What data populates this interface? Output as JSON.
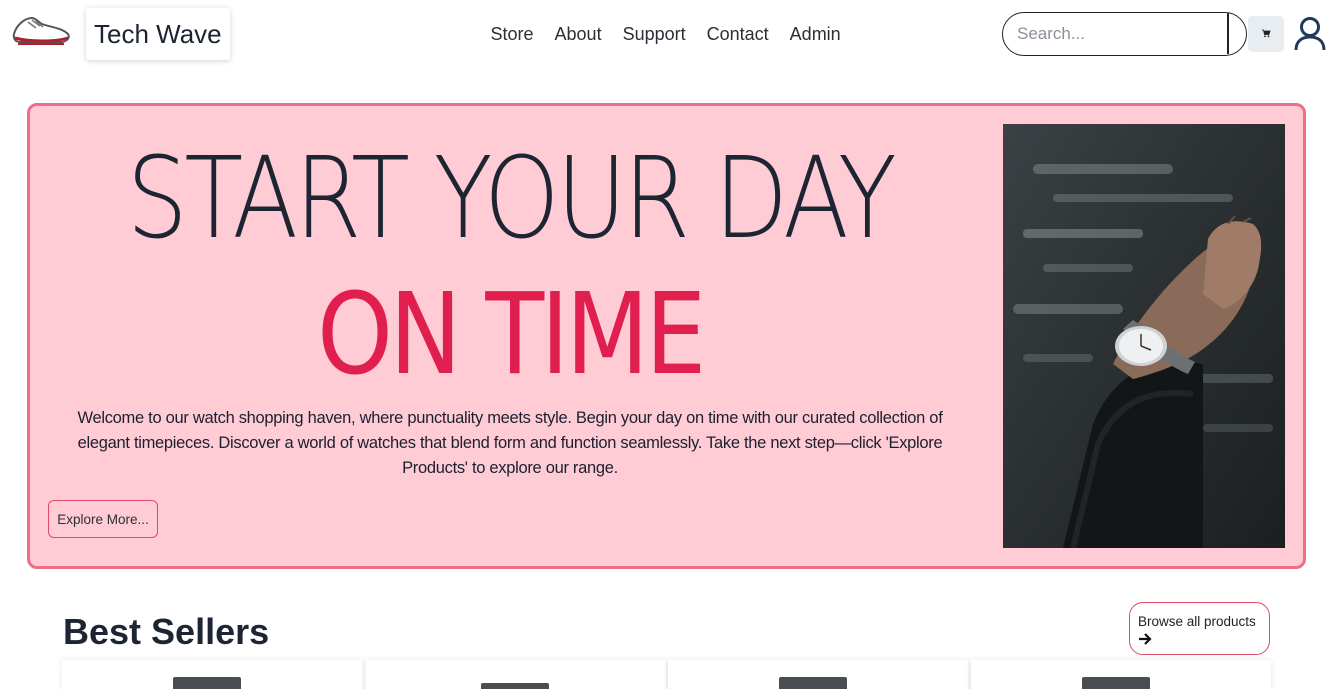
{
  "brand": {
    "name": "Tech Wave",
    "logo_icon": "sneaker-logo-icon"
  },
  "nav": {
    "links": [
      "Store",
      "About",
      "Support",
      "Contact",
      "Admin"
    ]
  },
  "search": {
    "placeholder": "Search..."
  },
  "header_icons": {
    "cart": "cart-icon",
    "user": "user-icon"
  },
  "hero": {
    "line1": "START YOUR DAY",
    "line2": "ON TIME",
    "text": "Welcome to our watch shopping haven, where punctuality meets style. Begin your day on time with our curated collection of elegant timepieces. Discover a world of watches that blend form and function seamlessly. Take the next step—click 'Explore Products' to explore our range.",
    "button": "Explore More...",
    "colors": {
      "background": "#ffccd5",
      "border": "#ee6e87",
      "accent": "#e01f4f"
    }
  },
  "best_sellers": {
    "title": "Best Sellers",
    "browse_label": "Browse all products",
    "browse_icon": "arrow-right-icon"
  }
}
